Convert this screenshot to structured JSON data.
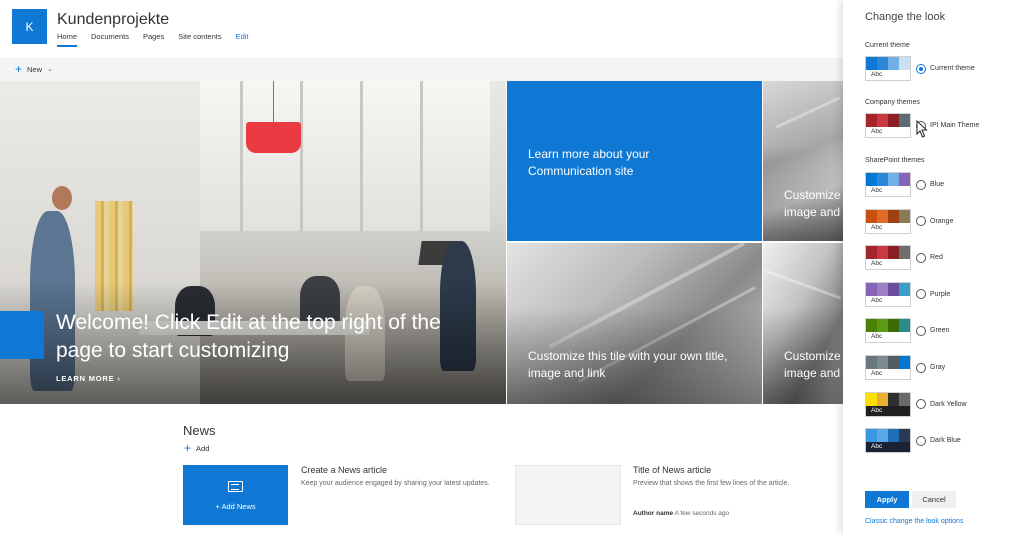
{
  "site": {
    "logo_letter": "K",
    "title": "Kundenprojekte",
    "nav": [
      "Home",
      "Documents",
      "Pages",
      "Site contents",
      "Edit"
    ]
  },
  "command_bar": {
    "new_label": "New"
  },
  "hero": {
    "title": "Welcome! Click Edit at the top right of the page to start customizing",
    "learn_more": "LEARN MORE",
    "tile_blue": "Learn more about your Communication site",
    "tile_top_right": "Customize this tile with your own title, image and link",
    "tile_bottom_mid": "Customize this tile with your own title, image and link",
    "tile_bottom_right": "Customize this tile with your own title, image and link"
  },
  "news": {
    "title": "News",
    "add_label": "Add",
    "add_news_label": "Add News",
    "create_title": "Create a News article",
    "create_desc": "Keep your audience engaged by sharing your latest updates.",
    "article_title": "Title of News article",
    "article_desc": "Preview that shows the first few lines of the article.",
    "author": "Author name",
    "time": "A few seconds ago"
  },
  "panel": {
    "title": "Change the look",
    "current_section": "Current theme",
    "company_section": "Company themes",
    "sharepoint_section": "SharePoint themes",
    "swatch_text": "Abc",
    "current_theme": {
      "name": "Current theme",
      "colors": [
        "#0f78d4",
        "#2b88d8",
        "#71afe5",
        "#c7e0f4"
      ],
      "bottom": "#ffffff",
      "bottom_text": "#333333"
    },
    "company_themes": [
      {
        "name": "IPI Main Theme",
        "colors": [
          "#a4262c",
          "#c83a3f",
          "#8a1f24",
          "#5c6b74"
        ],
        "bottom": "#ffffff",
        "bottom_text": "#333333"
      }
    ],
    "sharepoint_themes": [
      {
        "name": "Blue",
        "colors": [
          "#0078d4",
          "#2b88d8",
          "#71afe5",
          "#8764b8"
        ],
        "bottom": "#ffffff",
        "bottom_text": "#333333"
      },
      {
        "name": "Orange",
        "colors": [
          "#ca5010",
          "#e06a2a",
          "#a14010",
          "#8a7a5a"
        ],
        "bottom": "#ffffff",
        "bottom_text": "#333333"
      },
      {
        "name": "Red",
        "colors": [
          "#a4262c",
          "#c83a3f",
          "#8a1f24",
          "#6e6e6e"
        ],
        "bottom": "#ffffff",
        "bottom_text": "#333333"
      },
      {
        "name": "Purple",
        "colors": [
          "#8764b8",
          "#9d7fc6",
          "#6b4b9b",
          "#3aa0c8"
        ],
        "bottom": "#ffffff",
        "bottom_text": "#333333"
      },
      {
        "name": "Green",
        "colors": [
          "#498205",
          "#5a9a15",
          "#3b6a04",
          "#2b8a8a"
        ],
        "bottom": "#ffffff",
        "bottom_text": "#333333"
      },
      {
        "name": "Gray",
        "colors": [
          "#69797e",
          "#7d8c91",
          "#525e62",
          "#0078d4"
        ],
        "bottom": "#ffffff",
        "bottom_text": "#333333"
      },
      {
        "name": "Dark Yellow",
        "colors": [
          "#fce100",
          "#e8b02e",
          "#2f2f2f",
          "#6a6a6a"
        ],
        "bottom": "#1f1f1f",
        "bottom_text": "#ffffff"
      },
      {
        "name": "Dark Blue",
        "colors": [
          "#3a96dd",
          "#5aa9e6",
          "#1e6fb6",
          "#2b3a55"
        ],
        "bottom": "#1a2333",
        "bottom_text": "#ffffff"
      }
    ],
    "apply_label": "Apply",
    "cancel_label": "Cancel",
    "classic_link": "Classic change the look options"
  }
}
